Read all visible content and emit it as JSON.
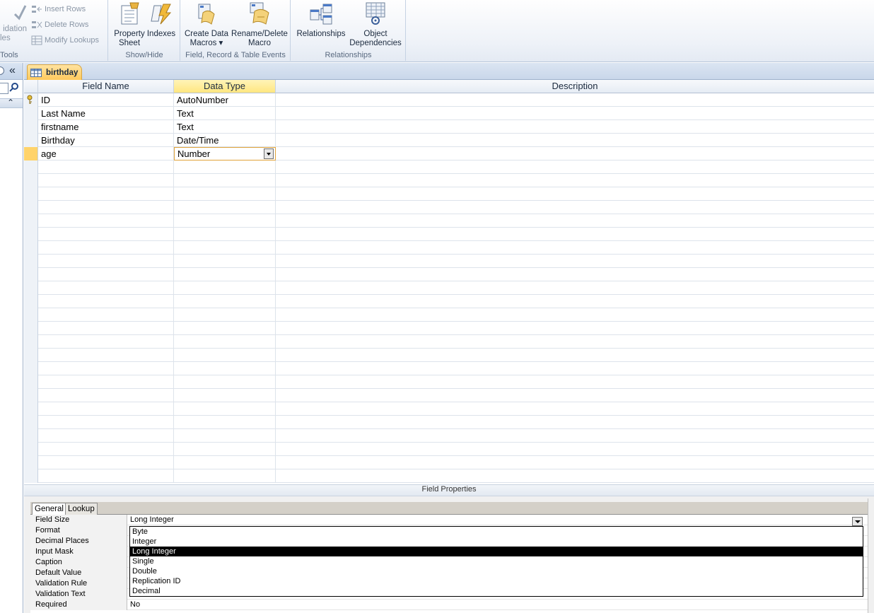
{
  "ribbon": {
    "tools_group": {
      "label": "Tools",
      "validation_line1": "idation",
      "validation_line2": "les",
      "insert_rows": "Insert Rows",
      "delete_rows": "Delete Rows",
      "modify_lookups": "Modify Lookups"
    },
    "showhide_group": {
      "label": "Show/Hide",
      "property_sheet_line1": "Property",
      "property_sheet_line2": "Sheet",
      "indexes": "Indexes"
    },
    "events_group": {
      "label": "Field, Record & Table Events",
      "create_macros_line1": "Create Data",
      "create_macros_line2": "Macros ▾",
      "rename_macro_line1": "Rename/Delete",
      "rename_macro_line2": "Macro"
    },
    "relationships_group": {
      "label": "Relationships",
      "relationships": "Relationships",
      "object_deps_line1": "Object",
      "object_deps_line2": "Dependencies"
    }
  },
  "nav": {
    "collapse_glyph": "«",
    "expand_glyph": "⌃"
  },
  "document_tab": {
    "title": "birthday"
  },
  "table": {
    "headers": {
      "field_name": "Field Name",
      "data_type": "Data Type",
      "description": "Description"
    },
    "rows": [
      {
        "name": "ID",
        "type": "AutoNumber",
        "description": "",
        "primary_key": true
      },
      {
        "name": "Last Name",
        "type": "Text",
        "description": ""
      },
      {
        "name": "firstname",
        "type": "Text",
        "description": ""
      },
      {
        "name": "Birthday",
        "type": "Date/Time",
        "description": ""
      },
      {
        "name": "age",
        "type": "Number",
        "description": "",
        "selected": true
      }
    ]
  },
  "field_properties": {
    "title": "Field Properties",
    "tabs": [
      "General",
      "Lookup"
    ],
    "rows": [
      {
        "label": "Field Size",
        "value": "Long Integer"
      },
      {
        "label": "Format",
        "value": ""
      },
      {
        "label": "Decimal Places",
        "value": ""
      },
      {
        "label": "Input Mask",
        "value": ""
      },
      {
        "label": "Caption",
        "value": ""
      },
      {
        "label": "Default Value",
        "value": ""
      },
      {
        "label": "Validation Rule",
        "value": ""
      },
      {
        "label": "Validation Text",
        "value": ""
      },
      {
        "label": "Required",
        "value": "No"
      }
    ],
    "field_size_options": [
      "Byte",
      "Integer",
      "Long Integer",
      "Single",
      "Double",
      "Replication ID",
      "Decimal"
    ],
    "field_size_selected": "Long Integer"
  },
  "colors": {
    "accent": "#ffc95c",
    "header_active": "#ffe680",
    "selection": "#000000"
  }
}
